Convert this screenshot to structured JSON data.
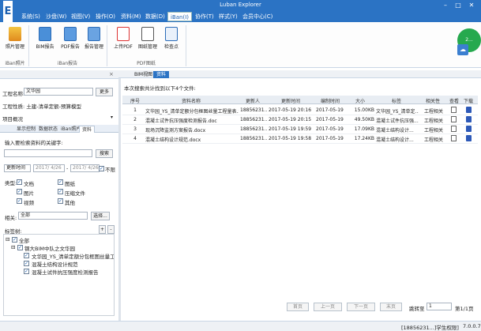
{
  "window": {
    "title": "Luban Explorer",
    "logo": "E",
    "minimize": "–",
    "maximize": "□",
    "close": "✕"
  },
  "menu": [
    "系统(S)",
    "沙盘(W)",
    "视图(V)",
    "操作(O)",
    "资料(M)",
    "数据(D)",
    "iBan(I)",
    "协作(T)",
    "样式(Y)",
    "会员中心(C)"
  ],
  "ribbon": {
    "buttons": [
      "照片管理",
      "BIM报告",
      "PDF报告",
      "报告管理",
      "上传PDF",
      "图纸管理",
      "检查点"
    ],
    "groups": [
      "iBan照片",
      "iBan报告",
      "PDF图纸"
    ],
    "badge": "2..."
  },
  "left": {
    "project_label": "工程名称:",
    "project_value": "文华园",
    "more_button": "更多",
    "project_type": "工程性质:  土建-清单定额-预算模型",
    "section": "项目概况",
    "tabs": [
      "显示控制",
      "数据状态",
      "iBan照片",
      "资料"
    ],
    "search_label": "输入要检索资料的关键字:",
    "search_button": "搜索",
    "time_label": "更新时间",
    "date_from": "2017/ 4/26",
    "date_to": "2017/ 4/26",
    "unlimited": "不限",
    "type_label": "类型:",
    "types": [
      {
        "label": "文档",
        "checked": true
      },
      {
        "label": "图纸",
        "checked": true
      },
      {
        "label": "图片",
        "checked": true
      },
      {
        "label": "压缩文件",
        "checked": true
      },
      {
        "label": "视频",
        "checked": true
      },
      {
        "label": "其他",
        "checked": true
      }
    ],
    "related_label": "相关:",
    "related_value": "全部",
    "select_button": "选择...",
    "tags_label": "标签树:",
    "tree": {
      "root": "全部",
      "node": "钢大BIM中队之文华园",
      "files": [
        "文华园_YS_清单定额分包框图丝量工程量表",
        "混凝土结构设计规范",
        "混凝土试件抗压强度检测报告"
      ]
    }
  },
  "right": {
    "tabs": [
      "BIM视图",
      "资料"
    ],
    "summary": "本次搜索共计找到以下4个文件:",
    "columns": [
      "序号",
      "资料名称",
      "更新人",
      "更新时间",
      "编制时间",
      "大小",
      "标签",
      "相关性",
      "查看",
      "下载"
    ],
    "rows": [
      {
        "no": "1",
        "name": "文华园_YS_清单定额分包框图丝量工程量表.xls",
        "user": "18856231...",
        "updated": "2017-05-19 20:16",
        "created": "2017-05-19",
        "size": "15.00KB",
        "tag": "文华园_YS_清单定...",
        "rel": "工程相关"
      },
      {
        "no": "2",
        "name": "混凝土试件抗压强度检测报告.doc",
        "user": "18856231...",
        "updated": "2017-05-19 20:15",
        "created": "2017-05-19",
        "size": "49.50KB",
        "tag": "混凝土试件抗压强...",
        "rel": "工程相关"
      },
      {
        "no": "3",
        "name": "现场沉降监测方案报告.docx",
        "user": "18856231...",
        "updated": "2017-05-19 19:59",
        "created": "2017-05-19",
        "size": "17.09KB",
        "tag": "混凝土结构设计...",
        "rel": "工程相关"
      },
      {
        "no": "4",
        "name": "混凝土结构设计规范.docx",
        "user": "18856231...",
        "updated": "2017-05-19 19:58",
        "created": "2017-05-19",
        "size": "17.24KB",
        "tag": "混凝土结构设计...",
        "rel": "工程相关"
      }
    ],
    "pager": {
      "first": "首页",
      "prev": "上一页",
      "next": "下一页",
      "last": "末页",
      "jump_label": "跳转至",
      "page_value": "1",
      "page_info": "第1/1页"
    }
  },
  "status": {
    "user": "[18856231...]学生权限]",
    "version": "7.0.0.7"
  },
  "colors": {
    "accent": "#2b73c4",
    "download": "#2d59b8"
  }
}
